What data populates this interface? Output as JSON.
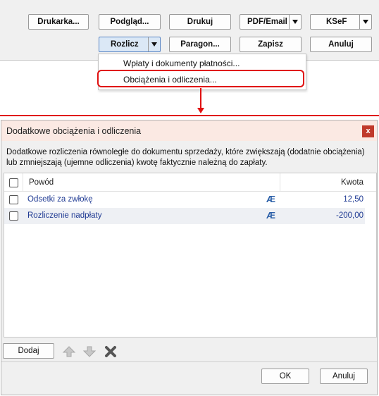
{
  "toolbar": {
    "printer": "Drukarka...",
    "preview": "Podgląd...",
    "print": "Drukuj",
    "pdf_email": "PDF/Email",
    "ksef": "KSeF",
    "settle": "Rozlicz",
    "receipt": "Paragon...",
    "save": "Zapisz",
    "cancel": "Anuluj"
  },
  "menu": {
    "payments": "Wpłaty i dokumenty płatności...",
    "charges": "Obciążenia i odliczenia..."
  },
  "dialog": {
    "title": "Dodatkowe obciążenia i odliczenia",
    "close_glyph": "x",
    "description": "Dodatkowe rozliczenia równoległe do dokumentu sprzedaży, które zwiększają (dodatnie obciążenia) lub zmniejszają (ujemne odliczenia) kwotę faktycznie należną do zapłaty.",
    "columns": {
      "reason": "Powód",
      "amount": "Kwota"
    },
    "rows": [
      {
        "reason": "Odsetki za zwłokę",
        "icon": "Æ",
        "amount": "12,50"
      },
      {
        "reason": "Rozliczenie nadpłaty",
        "icon": "Æ",
        "amount": "-200,00"
      }
    ],
    "add": "Dodaj",
    "ok": "OK",
    "cancel": "Anuluj"
  },
  "colors": {
    "highlight": "#e01010",
    "link": "#1f3a93",
    "title_bg": "#fbe9e3",
    "close_bg": "#c0392b"
  }
}
